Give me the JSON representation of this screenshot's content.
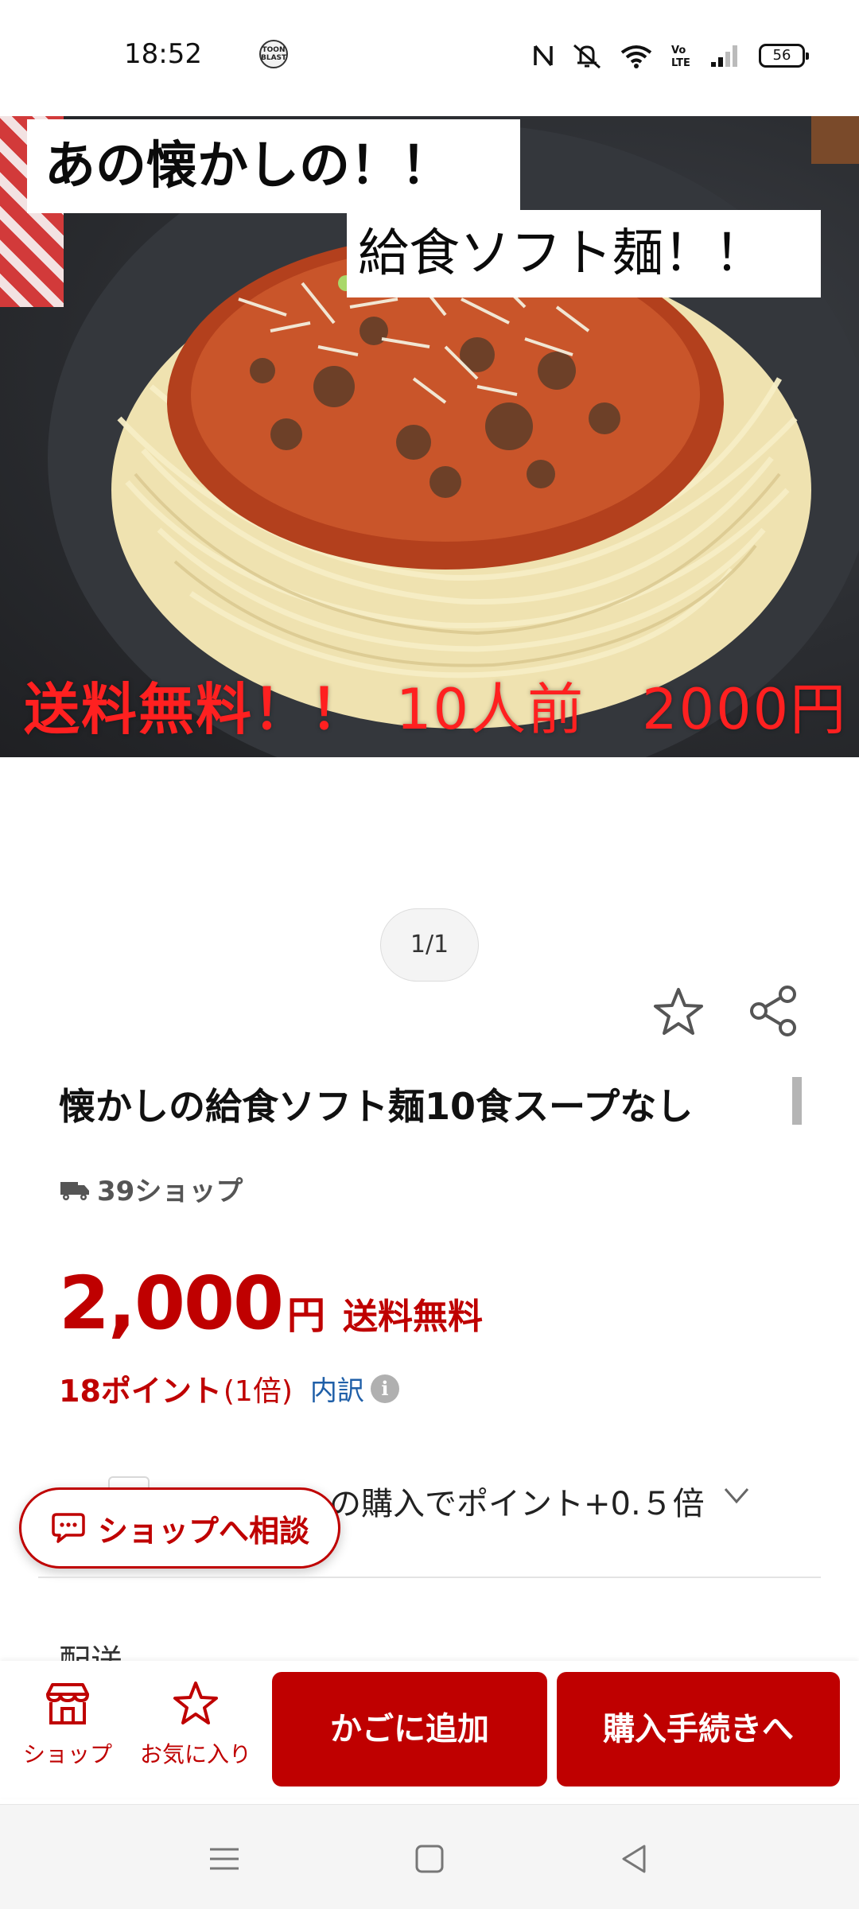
{
  "status_bar": {
    "time": "18:52",
    "app_icon_text": "TOON BLAST",
    "battery": "56"
  },
  "hero": {
    "overlay_line1": "あの懐かしの！！",
    "overlay_line2": "給食ソフト麺！！",
    "overlay_line3": "送料無料！！",
    "overlay_line4": "10人前　2000円"
  },
  "image_counter": "1/1",
  "product": {
    "title": "懐かしの給食ソフト麺10食スープなし",
    "shop_name": "39ショップ",
    "price": "2,000",
    "currency": "円",
    "shipping": "送料無料",
    "points": "18ポイント",
    "points_multiplier": "(1倍)",
    "breakdown_label": "内訳",
    "bonus_text": "の購入でポイント+0.５倍",
    "cut_off_text": "配送"
  },
  "consult_button": {
    "label": "ショップへ相談"
  },
  "bottom_nav": {
    "shop_label": "ショップ",
    "favorite_label": "お気に入り",
    "add_to_cart_label": "かごに追加",
    "checkout_label": "購入手続きへ"
  },
  "colors": {
    "accent": "#bf0000",
    "link": "#1f5fa8"
  }
}
